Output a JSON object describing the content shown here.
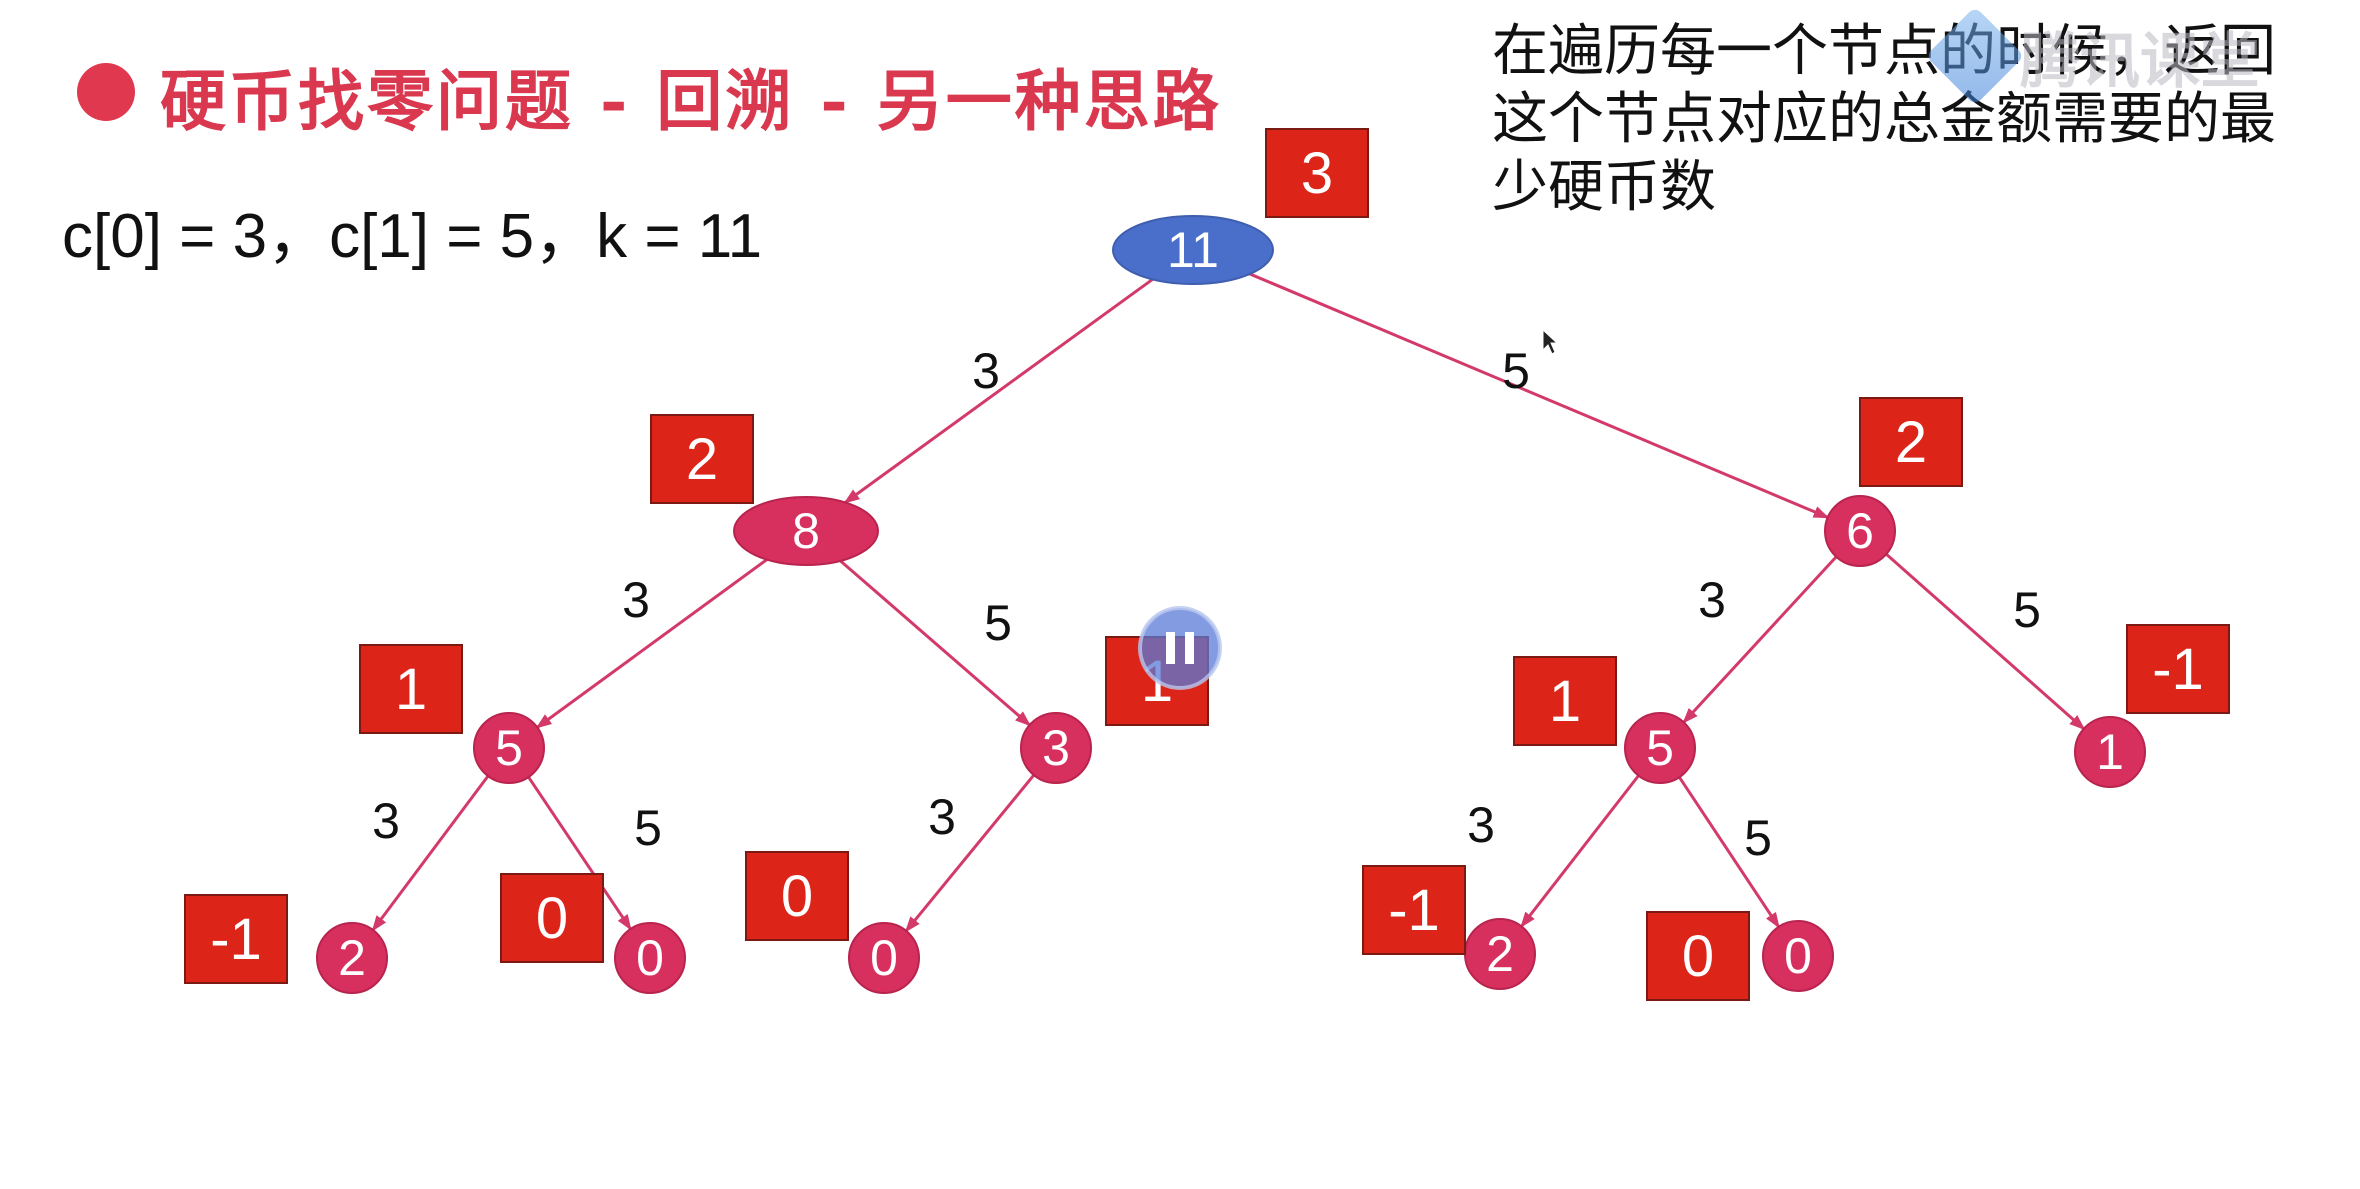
{
  "slide": {
    "title": "硬币找零问题 - 回溯 - 另一种思路",
    "params": "c[0] = 3，c[1] = 5，k = 11",
    "note": "在遍历每一个节点的时候，返回这个节点对应的总金额需要的最少硬币数"
  },
  "watermark": {
    "text": "腾讯课堂"
  },
  "colors": {
    "title": "#d9384f",
    "node": "#d7305f",
    "root_node": "#4a6fcb",
    "edge": "#d33a6a",
    "box": "#dc2418",
    "box_text": "#ffffff"
  },
  "tree": {
    "nodes": [
      {
        "id": "n11",
        "label": "11",
        "result": "3"
      },
      {
        "id": "n8",
        "label": "8",
        "result": "2"
      },
      {
        "id": "n6",
        "label": "6",
        "result": "2"
      },
      {
        "id": "n8a",
        "label": "5",
        "result": "1"
      },
      {
        "id": "n8b",
        "label": "3",
        "result": "1"
      },
      {
        "id": "n6a",
        "label": "5",
        "result": "1"
      },
      {
        "id": "n6b",
        "label": "1",
        "result": "-1"
      },
      {
        "id": "n8a1",
        "label": "2",
        "result": "-1"
      },
      {
        "id": "n8a2",
        "label": "0",
        "result": "0"
      },
      {
        "id": "n8b1",
        "label": "0",
        "result": "0"
      },
      {
        "id": "n6a1",
        "label": "2",
        "result": "-1"
      },
      {
        "id": "n6a2",
        "label": "0",
        "result": "0"
      }
    ],
    "edges": [
      {
        "from": "n11",
        "to": "n8",
        "coin": "3"
      },
      {
        "from": "n11",
        "to": "n6",
        "coin": "5"
      },
      {
        "from": "n8",
        "to": "n8a",
        "coin": "3"
      },
      {
        "from": "n8",
        "to": "n8b",
        "coin": "5"
      },
      {
        "from": "n6",
        "to": "n6a",
        "coin": "3"
      },
      {
        "from": "n6",
        "to": "n6b",
        "coin": "5"
      },
      {
        "from": "n8a",
        "to": "n8a1",
        "coin": "3"
      },
      {
        "from": "n8a",
        "to": "n8a2",
        "coin": "5"
      },
      {
        "from": "n8b",
        "to": "n8b1",
        "coin": "3"
      },
      {
        "from": "n6a",
        "to": "n6a1",
        "coin": "3"
      },
      {
        "from": "n6a",
        "to": "n6a2",
        "coin": "5"
      }
    ]
  }
}
